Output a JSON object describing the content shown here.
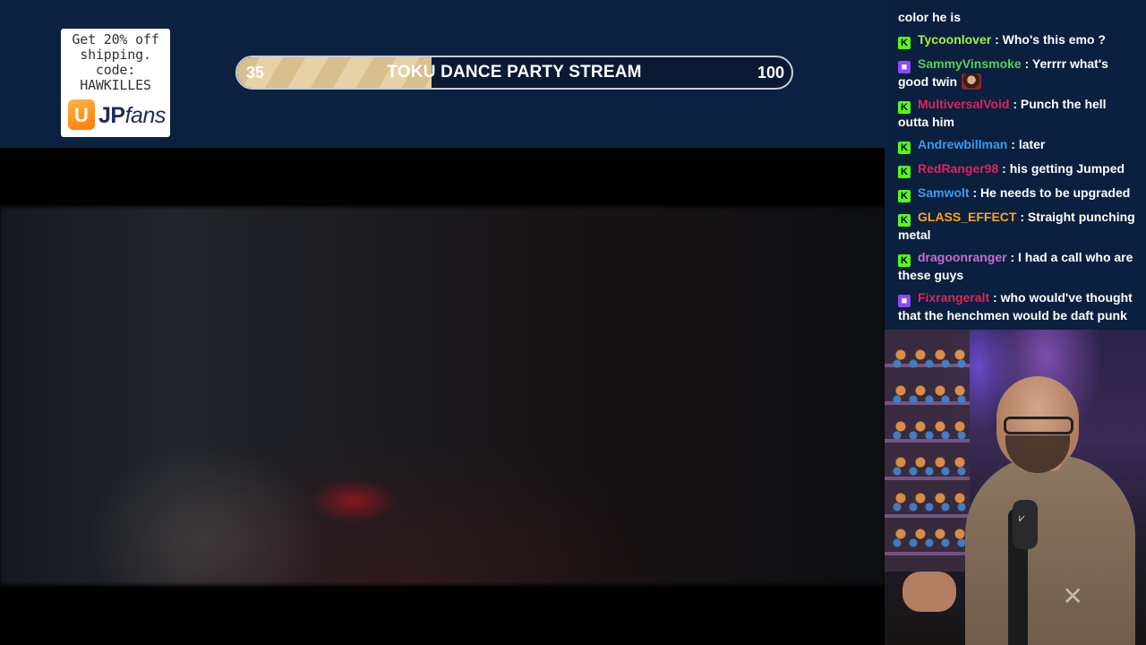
{
  "promo": {
    "text": "Get 20% off\nshipping.\ncode:\nHAWKILLES",
    "logo_icon": "U",
    "logo_text_a": "JP",
    "logo_text_b": "fans"
  },
  "goal": {
    "current": "35",
    "title": "TOKU DANCE PARTY STREAM",
    "target": "100",
    "progress": 0.35
  },
  "chat": {
    "messages": [
      {
        "user": "",
        "text": "color he is",
        "color": "#ffffff",
        "badge": "none"
      },
      {
        "user": "Tycoonlover",
        "text": "Who's this emo ?",
        "color": "#a8f03c",
        "badge": "kick"
      },
      {
        "user": "SammyVinsmoke",
        "text": "Yerrrr what's good twin",
        "color": "#53d35a",
        "badge": "twitch"
      },
      {
        "user": "MultiversalVoid",
        "text": "Punch the hell outta him",
        "color": "#e0245e",
        "badge": "kick"
      },
      {
        "user": "Andrewbillman",
        "text": "later",
        "color": "#3a9cf0",
        "badge": "kick"
      },
      {
        "user": "RedRanger98",
        "text": "his getting Jumped",
        "color": "#e0245e",
        "badge": "kick"
      },
      {
        "user": "Samwolt",
        "text": "He needs to be upgraded",
        "color": "#3a9cf0",
        "badge": "kick"
      },
      {
        "user": "GLASS_EFFECT",
        "text": "Straight punching metal",
        "color": "#f5a623",
        "badge": "kick"
      },
      {
        "user": "dragoonranger",
        "text": "I had a call who are these guys",
        "color": "#c86dd7",
        "badge": "kick"
      },
      {
        "user": "Fixrangeralt",
        "text": "who would've thought that the henchmen would be daft punk",
        "color": "#e0245e",
        "badge": "twitch"
      }
    ]
  },
  "icons": {
    "kick_badge": "kick-badge-icon",
    "twitch_badge": "twitch-badge-icon",
    "close": "close-icon"
  },
  "colors": {
    "background": "#0c203f",
    "goal_fill": "#d8bf8e",
    "kick": "#53fc18",
    "twitch": "#9146ff"
  }
}
